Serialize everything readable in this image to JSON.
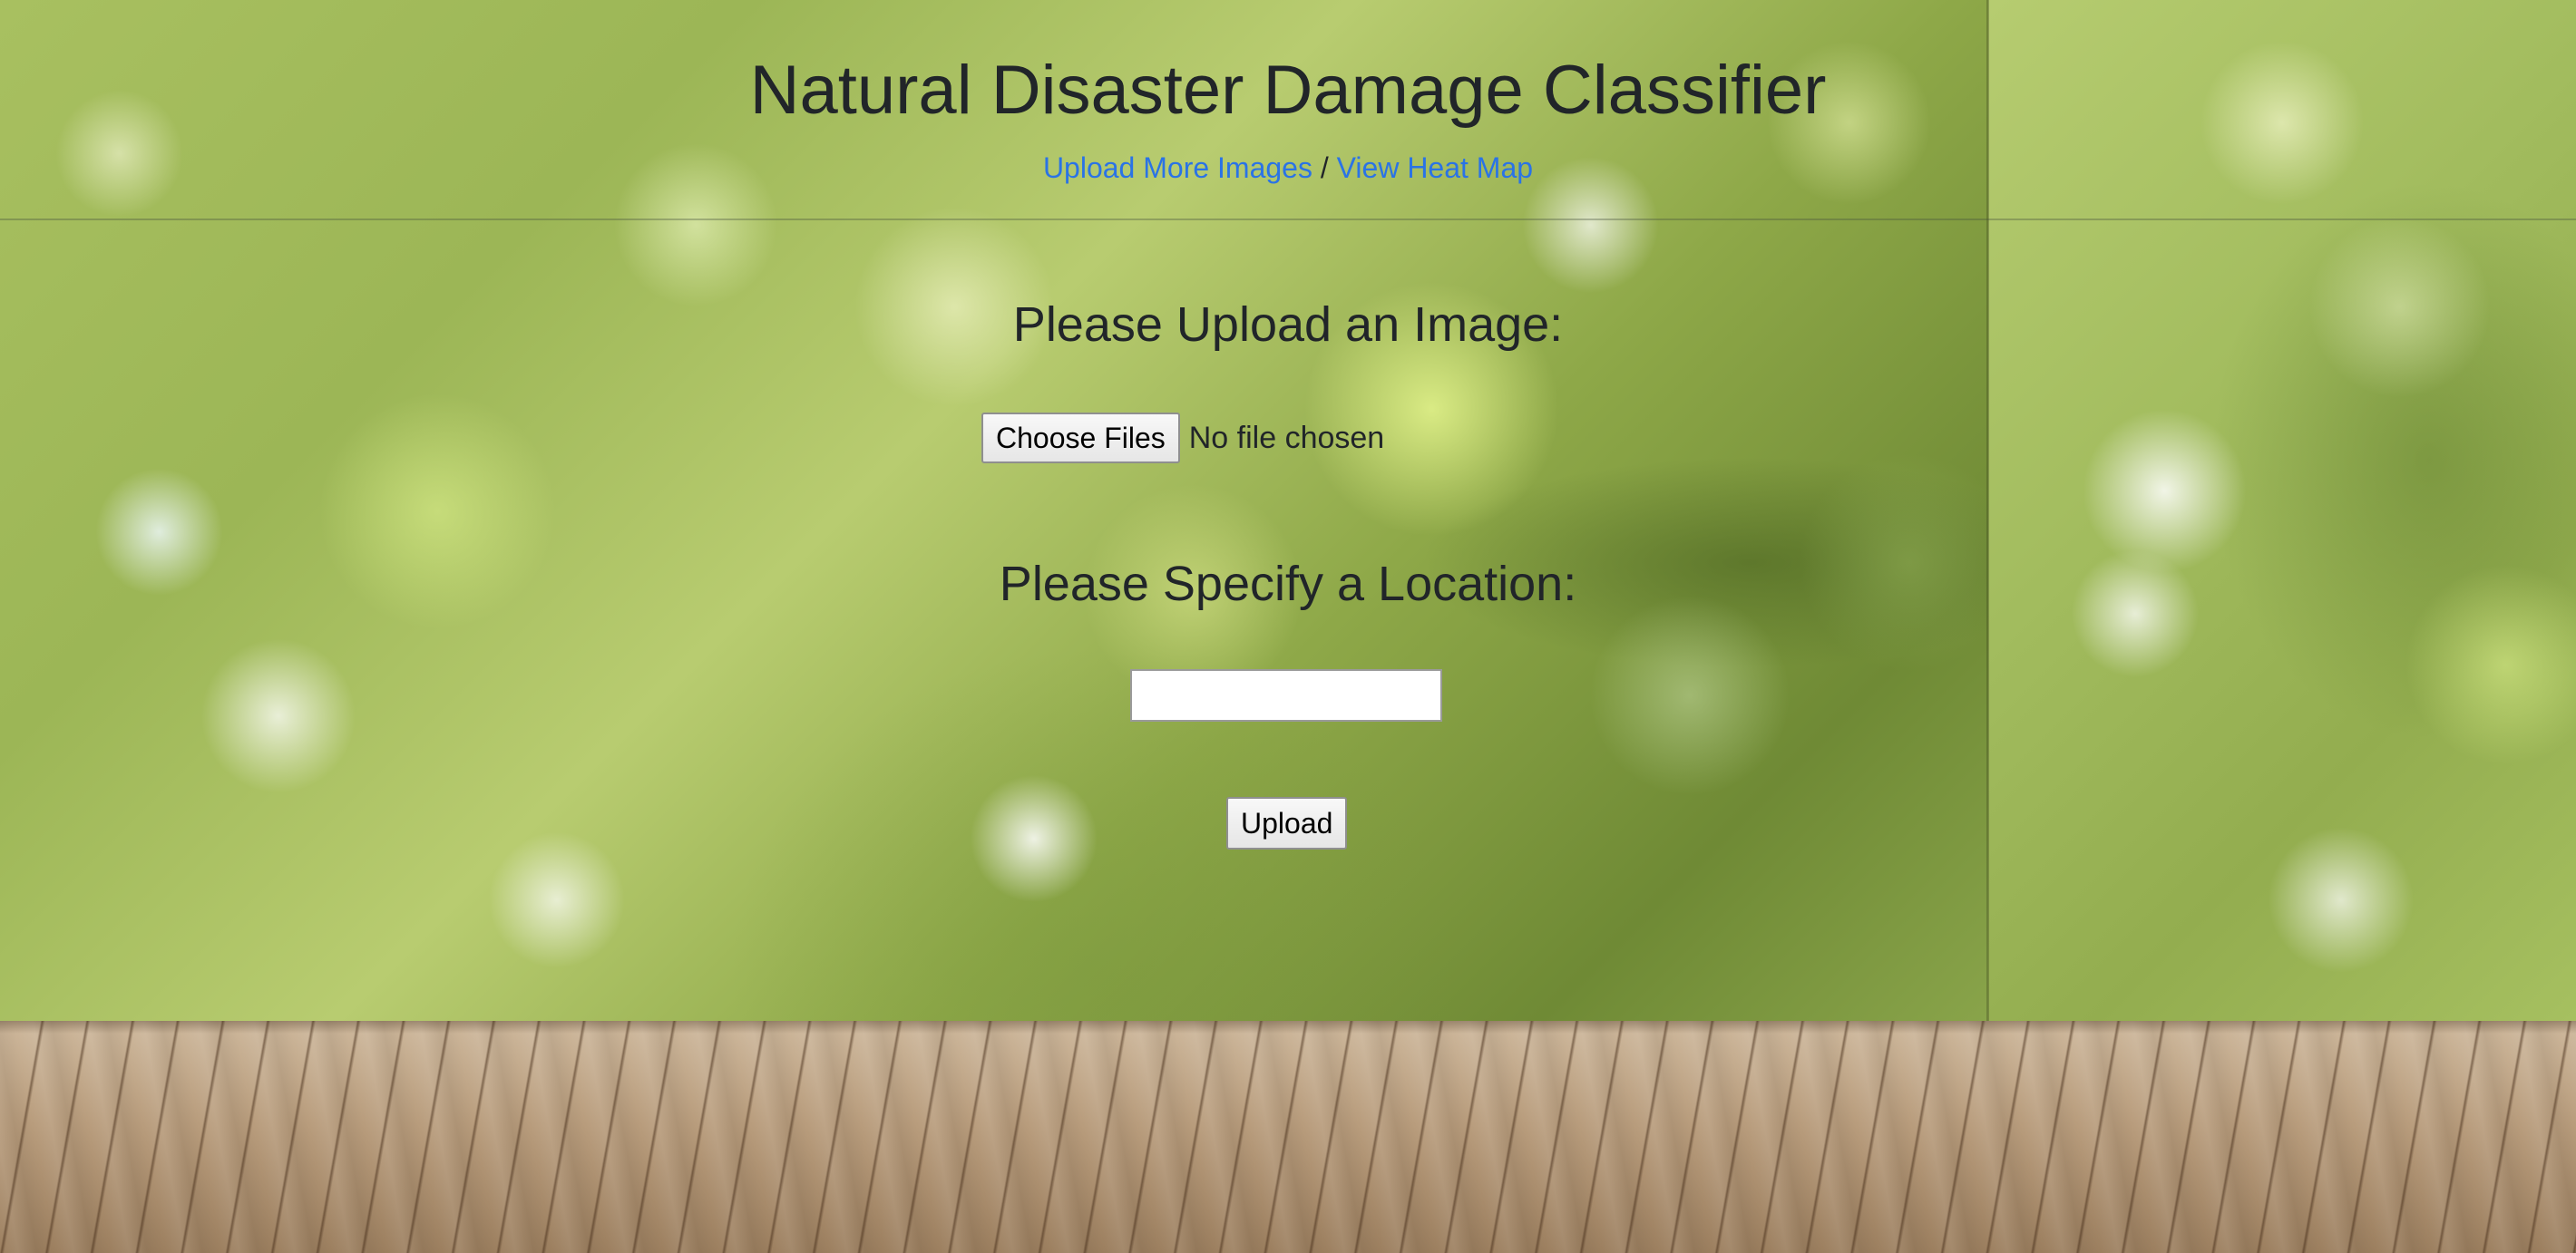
{
  "header": {
    "title": "Natural Disaster Damage Classifier",
    "links": [
      {
        "label": "Upload More Images"
      },
      {
        "label": "View Heat Map"
      }
    ],
    "separator": "/"
  },
  "form": {
    "upload_heading": "Please Upload an Image:",
    "choose_files_label": "Choose Files",
    "file_status": "No file chosen",
    "location_heading": "Please Specify a Location:",
    "location_value": "",
    "submit_label": "Upload"
  },
  "colors": {
    "link": "#2a73e6",
    "text": "#212529"
  }
}
